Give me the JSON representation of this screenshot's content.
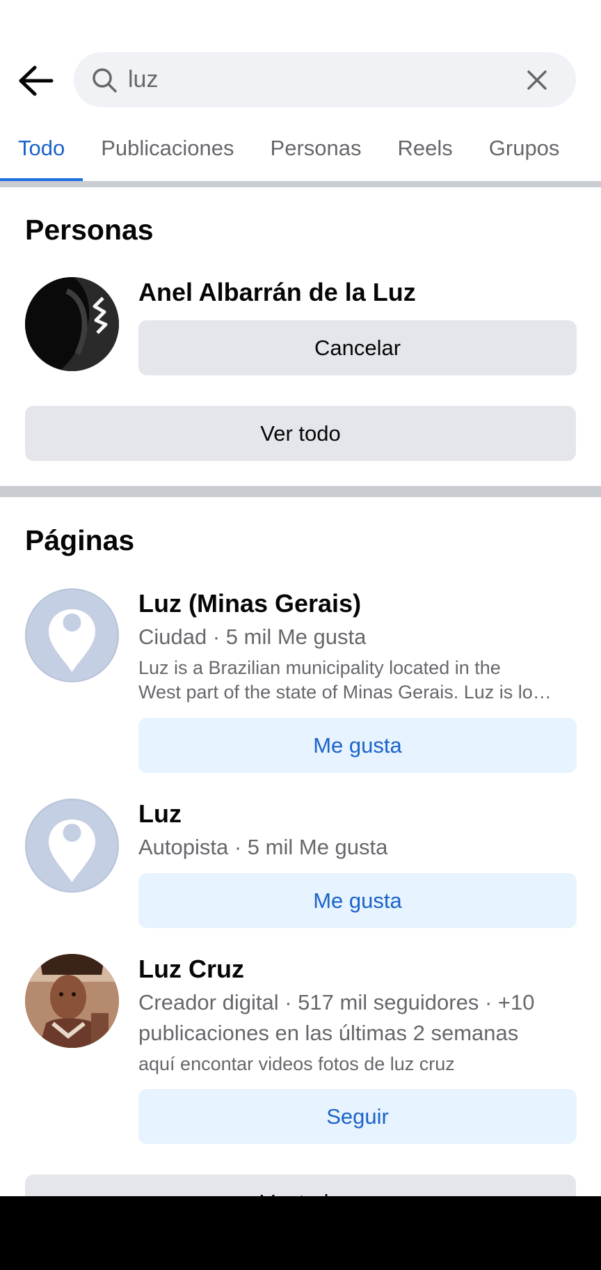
{
  "search": {
    "query": "luz"
  },
  "tabs": [
    {
      "label": "Todo",
      "active": true
    },
    {
      "label": "Publicaciones",
      "active": false
    },
    {
      "label": "Personas",
      "active": false
    },
    {
      "label": "Reels",
      "active": false
    },
    {
      "label": "Grupos",
      "active": false
    }
  ],
  "people_section": {
    "title": "Personas",
    "person": {
      "name": "Anel Albarrán de la Luz",
      "button_label": "Cancelar"
    },
    "see_all_label": "Ver todo"
  },
  "pages_section": {
    "title": "Páginas",
    "items": [
      {
        "name": "Luz (Minas Gerais)",
        "meta": "Ciudad · 5 mil Me gusta",
        "description_line1": "Luz is a Brazilian municipality located in the",
        "description_line2": "West part of the state of Minas Gerais. Luz is lo…",
        "button_label": "Me gusta",
        "avatar_icon": "location-pin-icon"
      },
      {
        "name": "Luz",
        "meta": "Autopista · 5 mil Me gusta",
        "button_label": "Me gusta",
        "avatar_icon": "location-pin-icon"
      },
      {
        "name": "Luz Cruz",
        "meta_line1": "Creador digital · 517 mil seguidores · +10",
        "meta_line2": "publicaciones en las últimas 2 semanas",
        "description": "aquí encontar videos fotos de luz cruz",
        "button_label": "Seguir"
      }
    ],
    "see_all_label": "Ver todo"
  },
  "colors": {
    "accent": "#1b6ee0",
    "light_blue_button": "#e7f3ff",
    "grey_button": "#e4e6eb",
    "divider": "#c9ccd1",
    "pin_avatar": "#c5cfe3"
  }
}
